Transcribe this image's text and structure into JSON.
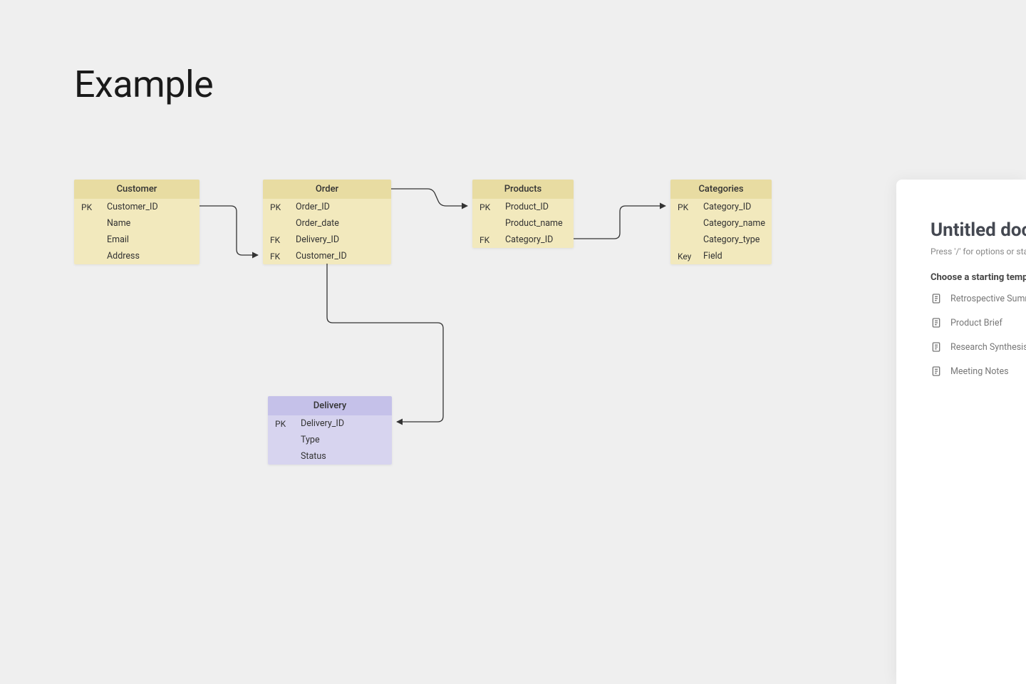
{
  "page_title": "Example",
  "entities": {
    "customer": {
      "title": "Customer",
      "rows": [
        {
          "key": "PK",
          "field": "Customer_ID"
        },
        {
          "key": "",
          "field": "Name"
        },
        {
          "key": "",
          "field": "Email"
        },
        {
          "key": "",
          "field": "Address"
        }
      ]
    },
    "order": {
      "title": "Order",
      "rows": [
        {
          "key": "PK",
          "field": "Order_ID"
        },
        {
          "key": "",
          "field": "Order_date"
        },
        {
          "key": "FK",
          "field": "Delivery_ID"
        },
        {
          "key": "FK",
          "field": "Customer_ID"
        }
      ]
    },
    "products": {
      "title": "Products",
      "rows": [
        {
          "key": "PK",
          "field": "Product_ID"
        },
        {
          "key": "",
          "field": "Product_name"
        },
        {
          "key": "FK",
          "field": "Category_ID"
        }
      ]
    },
    "categories": {
      "title": "Categories",
      "rows": [
        {
          "key": "PK",
          "field": "Category_ID"
        },
        {
          "key": "",
          "field": "Category_name"
        },
        {
          "key": "",
          "field": "Category_type"
        },
        {
          "key": "Key",
          "field": "Field"
        }
      ]
    },
    "delivery": {
      "title": "Delivery",
      "rows": [
        {
          "key": "PK",
          "field": "Delivery_ID"
        },
        {
          "key": "",
          "field": "Type"
        },
        {
          "key": "",
          "field": "Status"
        }
      ]
    }
  },
  "side_panel": {
    "title": "Untitled doc",
    "hint": "Press '/' for options or start w",
    "subhead": "Choose a starting templa",
    "templates": [
      "Retrospective Summar",
      "Product Brief",
      "Research Synthesis",
      "Meeting Notes"
    ]
  }
}
